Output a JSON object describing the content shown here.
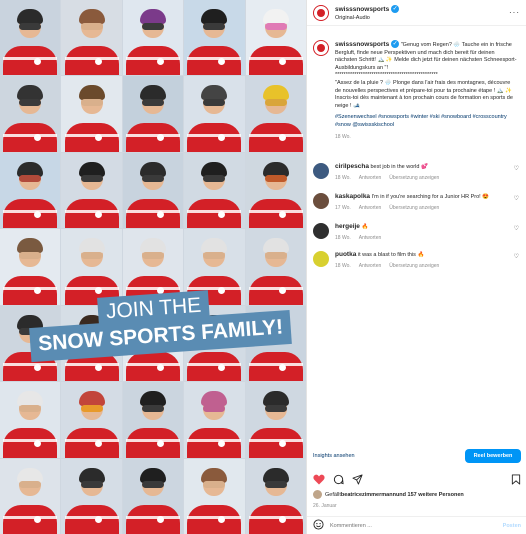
{
  "media": {
    "banner_line1": "JOIN THE",
    "banner_line2": "SNOW SPORTS FAMILY!",
    "tiles": [
      {
        "bg": "#c9d3de",
        "helmet": "#2b2b2b",
        "goggle": "#3a3a3a"
      },
      {
        "bg": "#d7dde4",
        "helmet": "#8a5a3c",
        "goggle": "#d9b08c"
      },
      {
        "bg": "#dfe7ef",
        "helmet": "#7b3a8a",
        "goggle": "#3a3a3a"
      },
      {
        "bg": "#c8d9e8",
        "helmet": "#1f1f1f",
        "goggle": "#3a3a3a"
      },
      {
        "bg": "#e6ecf2",
        "helmet": "#f2f2f2",
        "goggle": "#e07ab5"
      },
      {
        "bg": "#cdd6df",
        "helmet": "#333333",
        "goggle": "#3a3a3a"
      },
      {
        "bg": "#e2e8ee",
        "helmet": "#6b4a2c",
        "goggle": "#d9b08c"
      },
      {
        "bg": "#c3d0dc",
        "helmet": "#2b2b2b",
        "goggle": "#3a3a3a"
      },
      {
        "bg": "#d9e1ea",
        "helmet": "#444444",
        "goggle": "#3a3a3a"
      },
      {
        "bg": "#cfd8e2",
        "helmet": "#e8c22a",
        "goggle": "#d9a53a"
      },
      {
        "bg": "#c7d7e6",
        "helmet": "#2b2b2b",
        "goggle": "#b24a3a"
      },
      {
        "bg": "#d3dbe4",
        "helmet": "#1f1f1f",
        "goggle": "#3a3a3a"
      },
      {
        "bg": "#c8d3de",
        "helmet": "#2b2b2b",
        "goggle": "#3a3a3a"
      },
      {
        "bg": "#d1dae3",
        "helmet": "#1f1f1f",
        "goggle": "#3a3a3a"
      },
      {
        "bg": "#cfd8e0",
        "helmet": "#2b2b2b",
        "goggle": "#c05a2a"
      },
      {
        "bg": "#e4eaf0",
        "helmet": "#7a5a40",
        "goggle": "#d9b08c"
      },
      {
        "bg": "#dde4eb",
        "helmet": "#e2e2e2",
        "goggle": "#d9b08c"
      },
      {
        "bg": "#dfe5ec",
        "helmet": "#e2e2e2",
        "goggle": "#d9b08c"
      },
      {
        "bg": "#d8e0e8",
        "helmet": "#e2e2e2",
        "goggle": "#d9b08c"
      },
      {
        "bg": "#d0d9e2",
        "helmet": "#e2e2e2",
        "goggle": "#d9b08c"
      },
      {
        "bg": "#cdd6df",
        "helmet": "#2b2b2b",
        "goggle": "#3a3a3a"
      },
      {
        "bg": "#d6dee6",
        "helmet": "#3a2a20",
        "goggle": "#3a3a3a"
      },
      {
        "bg": "#e3e9ef",
        "helmet": "#5a3a28",
        "goggle": "#d9b08c"
      },
      {
        "bg": "#d2dbe4",
        "helmet": "#1f1f1f",
        "goggle": "#3a3a3a"
      },
      {
        "bg": "#c9d4df",
        "helmet": "#2b2b2b",
        "goggle": "#3a3a3a"
      },
      {
        "bg": "#dfe6ed",
        "helmet": "#e7e7e7",
        "goggle": "#d9b08c"
      },
      {
        "bg": "#d4dce5",
        "helmet": "#c2453a",
        "goggle": "#e89a2a"
      },
      {
        "bg": "#cbd5df",
        "helmet": "#1f1f1f",
        "goggle": "#3a3a3a"
      },
      {
        "bg": "#d8e0e8",
        "helmet": "#c06090",
        "goggle": "#c06090"
      },
      {
        "bg": "#cfd8e1",
        "helmet": "#2b2b2b",
        "goggle": "#3a3a3a"
      },
      {
        "bg": "#dde3ea",
        "helmet": "#e7e7e7",
        "goggle": "#d9b08c"
      },
      {
        "bg": "#d5dde6",
        "helmet": "#2b2b2b",
        "goggle": "#3a3a3a"
      },
      {
        "bg": "#ccd6e0",
        "helmet": "#1f1f1f",
        "goggle": "#3a3a3a"
      },
      {
        "bg": "#e1e8ee",
        "helmet": "#8a5a3c",
        "goggle": "#d9b08c"
      },
      {
        "bg": "#d2dae3",
        "helmet": "#2b2b2b",
        "goggle": "#3a3a3a"
      }
    ]
  },
  "header": {
    "username": "swisssnowsports",
    "subtitle": "Original-Audio",
    "more": "···"
  },
  "caption": {
    "username": "swisssnowsports",
    "text_de": "\"Genug vom Regen? 🌧️ Tauche ein in frische Bergluft, finde neue Perspektiven und mach dich bereit für deinen nächsten Schritt! 🏔️ ✨ Melde dich jetzt für deinen nächsten Schneesport-Ausbildungskurs an \"!",
    "divider": "************************************************",
    "text_fr": "\"Assez de la pluie ? 🌧️ Plonge dans l'air frais des montagnes, découvre de nouvelles perspectives et prépare-toi pour ta prochaine étape ! 🏔️ ✨ Inscris-toi dès maintenant à ton prochain cours de formation en sports de neige ! 🎿",
    "hashtags": "#Szenenwechsel #snowsports #winter #ski #snowboard #crosscountry #snow @swissskischool",
    "age": "18 Wo."
  },
  "comments": [
    {
      "username": "cirilpescha",
      "text": "best job in the world 💕",
      "age": "18 Wo.",
      "reply": "Antworten",
      "translate": "Übersetzung anzeigen",
      "color": "#3d5a80"
    },
    {
      "username": "kaskapolka",
      "text": "I'm in if you're searching for a Junior HR Pro! 😍",
      "age": "17 Wo.",
      "reply": "Antworten",
      "translate": "Übersetzung anzeigen",
      "color": "#6b4e3d"
    },
    {
      "username": "hergeije",
      "text": "🔥",
      "age": "18 Wo.",
      "reply": "Antworten",
      "translate": "",
      "color": "#2f2f2f"
    },
    {
      "username": "puotka",
      "text": "it was a blast to film this 🔥",
      "age": "18 Wo.",
      "reply": "Antworten",
      "translate": "Übersetzung anzeigen",
      "color": "#d8d030"
    }
  ],
  "insights": {
    "link": "Insights ansehen",
    "boost": "Reel bewerben"
  },
  "likes": {
    "prefix": "Gefällt ",
    "user": "beatricezimmermann",
    "suffix": " und 157 weitere Personen"
  },
  "date": "26. Januar",
  "comment_bar": {
    "placeholder": "Kommentieren ...",
    "post": "Posten"
  },
  "colors": {
    "accent": "#0095f6",
    "brand_red": "#d32027",
    "banner_blue": "#5a8cb3"
  }
}
